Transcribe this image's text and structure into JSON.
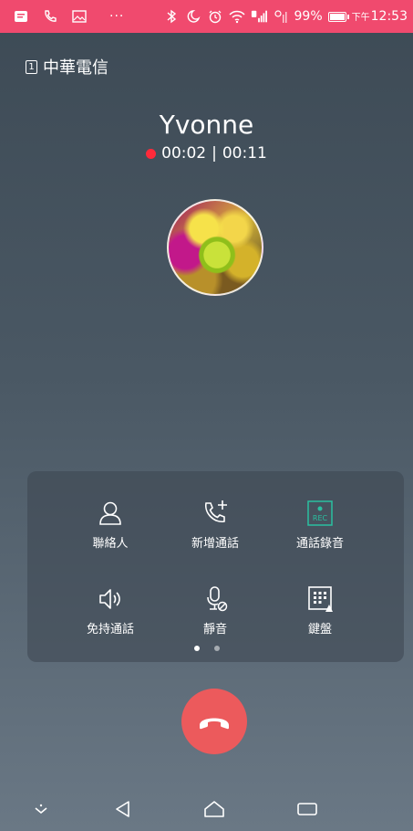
{
  "status_bar": {
    "icons": [
      "message-icon",
      "call-icon",
      "image-icon",
      "bluetooth-icon",
      "do-not-disturb-icon",
      "alarm-icon",
      "wifi-icon",
      "signal-icon"
    ],
    "more": "···",
    "battery": "99%",
    "time_prefix": "下午",
    "time": "12:53"
  },
  "carrier": {
    "sim": "1",
    "name": "中華電信"
  },
  "call": {
    "name": "Yvonne",
    "recording_timer": "00:02",
    "separator": "|",
    "call_timer": "00:11"
  },
  "controls": [
    {
      "label": "聯絡人",
      "icon": "contact-icon"
    },
    {
      "label": "新增通話",
      "icon": "add-call-icon"
    },
    {
      "label": "通話錄音",
      "icon": "record-icon",
      "icon_text": "REC"
    },
    {
      "label": "免持通話",
      "icon": "speaker-icon"
    },
    {
      "label": "靜音",
      "icon": "mute-mic-icon"
    },
    {
      "label": "鍵盤",
      "icon": "keypad-icon"
    }
  ],
  "page_indicator": {
    "pages": 2,
    "active": 1
  },
  "colors": {
    "status_bar": "#f04a6e",
    "end_call": "#ec5a5c",
    "record_accent": "#2ac0a0",
    "rec_dot": "#ff2a3a"
  }
}
